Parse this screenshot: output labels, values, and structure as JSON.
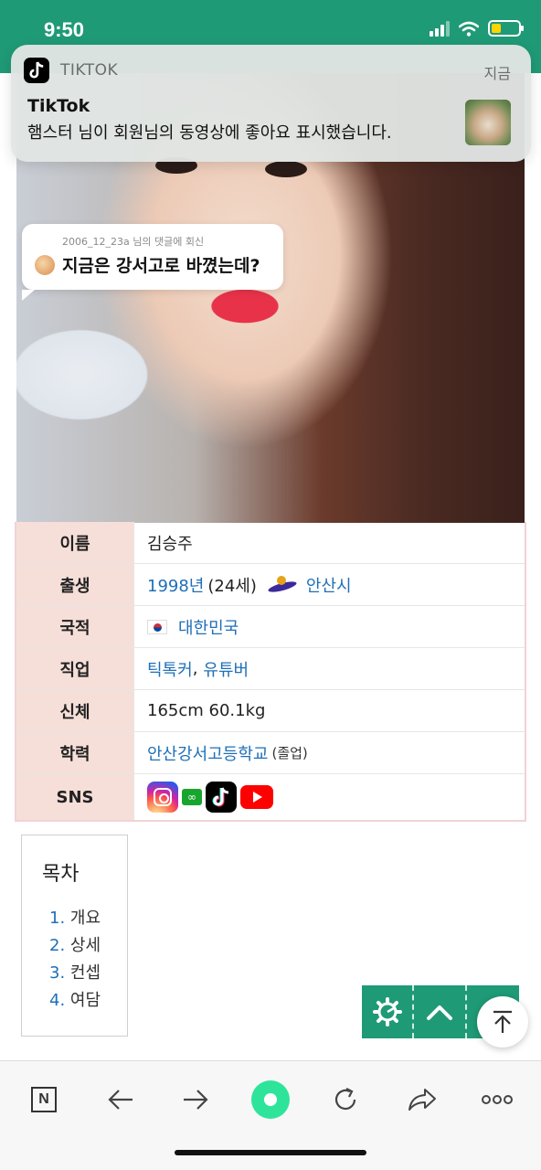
{
  "status_bar": {
    "time": "9:50",
    "icons": [
      "signal-icon",
      "wifi-icon",
      "battery-icon"
    ],
    "battery_color": "#ffd400"
  },
  "notification": {
    "app_name": "TIKTOK",
    "time": "지금",
    "title": "TikTok",
    "body": "햄스터 님이 회원님의 동영상에 좋아요 표시했습니다."
  },
  "comment_overlay": {
    "reply_meta": "2006_12_23a 님의 댓글에 회신",
    "text": "지금은 강서고로 바꼈는데?"
  },
  "infobox": {
    "rows": [
      {
        "key": "이름",
        "value": "김승주"
      },
      {
        "key": "출생",
        "year_link": "1998년",
        "age": "(24세)",
        "place_link": "안산시"
      },
      {
        "key": "국적",
        "value_link": "대한민국"
      },
      {
        "key": "직업",
        "link1": "틱톡커",
        "sep": ",",
        "link2": "유튜버"
      },
      {
        "key": "신체",
        "value": "165cm 60.1kg"
      },
      {
        "key": "학력",
        "value_link": "안산강서고등학교",
        "note": "(졸업)"
      },
      {
        "key": "SNS",
        "icons": [
          "instagram-icon",
          "link-icon",
          "tiktok-icon",
          "youtube-icon"
        ]
      }
    ],
    "key_bg": "#f6dfd8",
    "link_color": "#1f6fb8"
  },
  "toc": {
    "title": "목차",
    "items": [
      {
        "num": "1.",
        "label": "개요"
      },
      {
        "num": "2.",
        "label": "상세"
      },
      {
        "num": "3.",
        "label": "컨셉"
      },
      {
        "num": "4.",
        "label": "여담"
      }
    ]
  },
  "floating_tools": {
    "buttons": [
      "gear-icon",
      "chevron-up-icon",
      "more-icon"
    ],
    "color": "#1f9a76"
  },
  "bottom_toolbar": {
    "buttons": [
      "naver-home-icon",
      "back-arrow-icon",
      "forward-arrow-icon",
      "green-dot-icon",
      "refresh-icon",
      "share-icon",
      "more-dots-icon"
    ],
    "naver_letter": "N"
  },
  "theme": {
    "accent": "#1f9a76"
  }
}
